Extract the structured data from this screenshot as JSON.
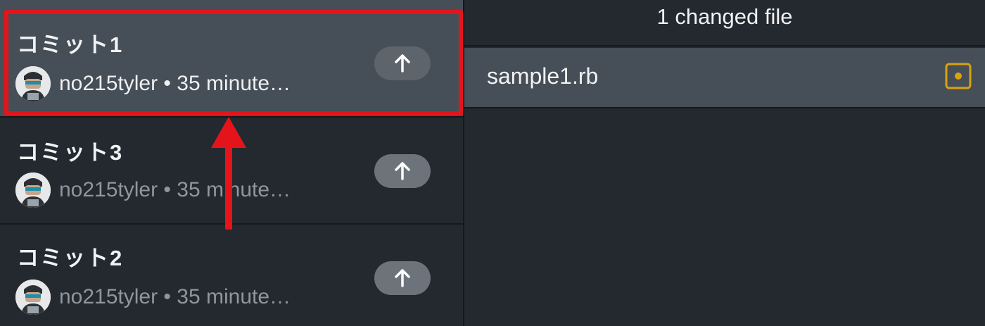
{
  "commits": [
    {
      "title": "コミット1",
      "meta": "no215tyler • 35 minute…",
      "push_icon": "arrow-up-icon",
      "selected": true
    },
    {
      "title": "コミット3",
      "meta": "no215tyler • 35 minute…",
      "push_icon": "arrow-up-icon",
      "selected": false
    },
    {
      "title": "コミット2",
      "meta": "no215tyler • 35 minute…",
      "push_icon": "arrow-up-icon",
      "selected": false
    }
  ],
  "changes": {
    "header": "1 changed file",
    "files": [
      {
        "name": "sample1.rb",
        "status_icon": "modified-file-icon"
      }
    ]
  },
  "colors": {
    "background": "#24292f",
    "selected": "#464e57",
    "annotation": "#e5141b",
    "modified": "#d9a30f"
  }
}
